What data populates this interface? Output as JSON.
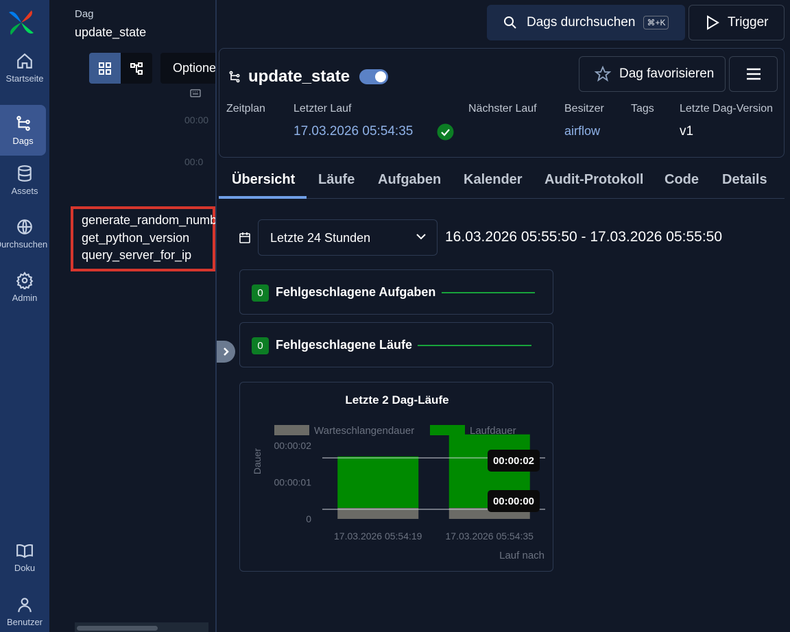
{
  "nav": {
    "items": [
      {
        "label": "Startseite",
        "icon": "home-icon"
      },
      {
        "label": "Dags",
        "icon": "dag-icon"
      },
      {
        "label": "Assets",
        "icon": "database-icon"
      },
      {
        "label": "Durchsuchen",
        "icon": "globe-icon"
      },
      {
        "label": "Admin",
        "icon": "gear-icon"
      },
      {
        "label": "Doku",
        "icon": "book-icon"
      },
      {
        "label": "Benutzer",
        "icon": "user-icon"
      }
    ]
  },
  "breadcrumb": {
    "label": "Dag",
    "name": "update_state"
  },
  "grid": {
    "options_label": "Optionen",
    "times": [
      "00:00",
      "00:0"
    ],
    "tasks": [
      "generate_random_number",
      "get_python_version",
      "query_server_for_ip"
    ]
  },
  "topbar": {
    "search_label": "Dags durchsuchen",
    "search_shortcut": "⌘+K",
    "trigger_label": "Trigger"
  },
  "header": {
    "dag_name": "update_state",
    "paused": false,
    "favorite_label": "Dag favorisieren",
    "meta": {
      "schedule_label": "Zeitplan",
      "last_run_label": "Letzter Lauf",
      "last_run_value": "17.03.2026 05:54:35",
      "next_run_label": "Nächster Lauf",
      "owner_label": "Besitzer",
      "owner_value": "airflow",
      "tags_label": "Tags",
      "version_label": "Letzte Dag-Version",
      "version_value": "v1"
    }
  },
  "tabs": [
    "Übersicht",
    "Läufe",
    "Aufgaben",
    "Kalender",
    "Audit-Protokoll",
    "Code",
    "Details"
  ],
  "overview": {
    "range_select": "Letzte 24 Stunden",
    "range_text": "16.03.2026 05:55:50 - 17.03.2026 05:55:50",
    "failed_tasks": {
      "count": "0",
      "label": "Fehlgeschlagene Aufgaben"
    },
    "failed_runs": {
      "count": "0",
      "label": "Fehlgeschlagene Läufe"
    }
  },
  "colors": {
    "queued": "#6b6b66",
    "run": "#008a00",
    "success": "#0c7d24",
    "accent": "#6f9ee6"
  },
  "chart_data": {
    "type": "bar",
    "title": "Letzte 2 Dag-Läufe",
    "xlabel": "Lauf nach",
    "ylabel": "Dauer",
    "categories": [
      "17.03.2026 05:54:19",
      "17.03.2026 05:54:35"
    ],
    "series": [
      {
        "name": "Warteschlangendauer",
        "values": [
          0.3,
          0.3
        ]
      },
      {
        "name": "Laufdauer",
        "values": [
          1.4,
          2.0
        ]
      }
    ],
    "yticks": [
      "0",
      "00:00:01",
      "00:00:02"
    ],
    "ylim": [
      0,
      2.5
    ],
    "tooltips": [
      "00:00:02",
      "00:00:00"
    ],
    "legend": "top"
  }
}
